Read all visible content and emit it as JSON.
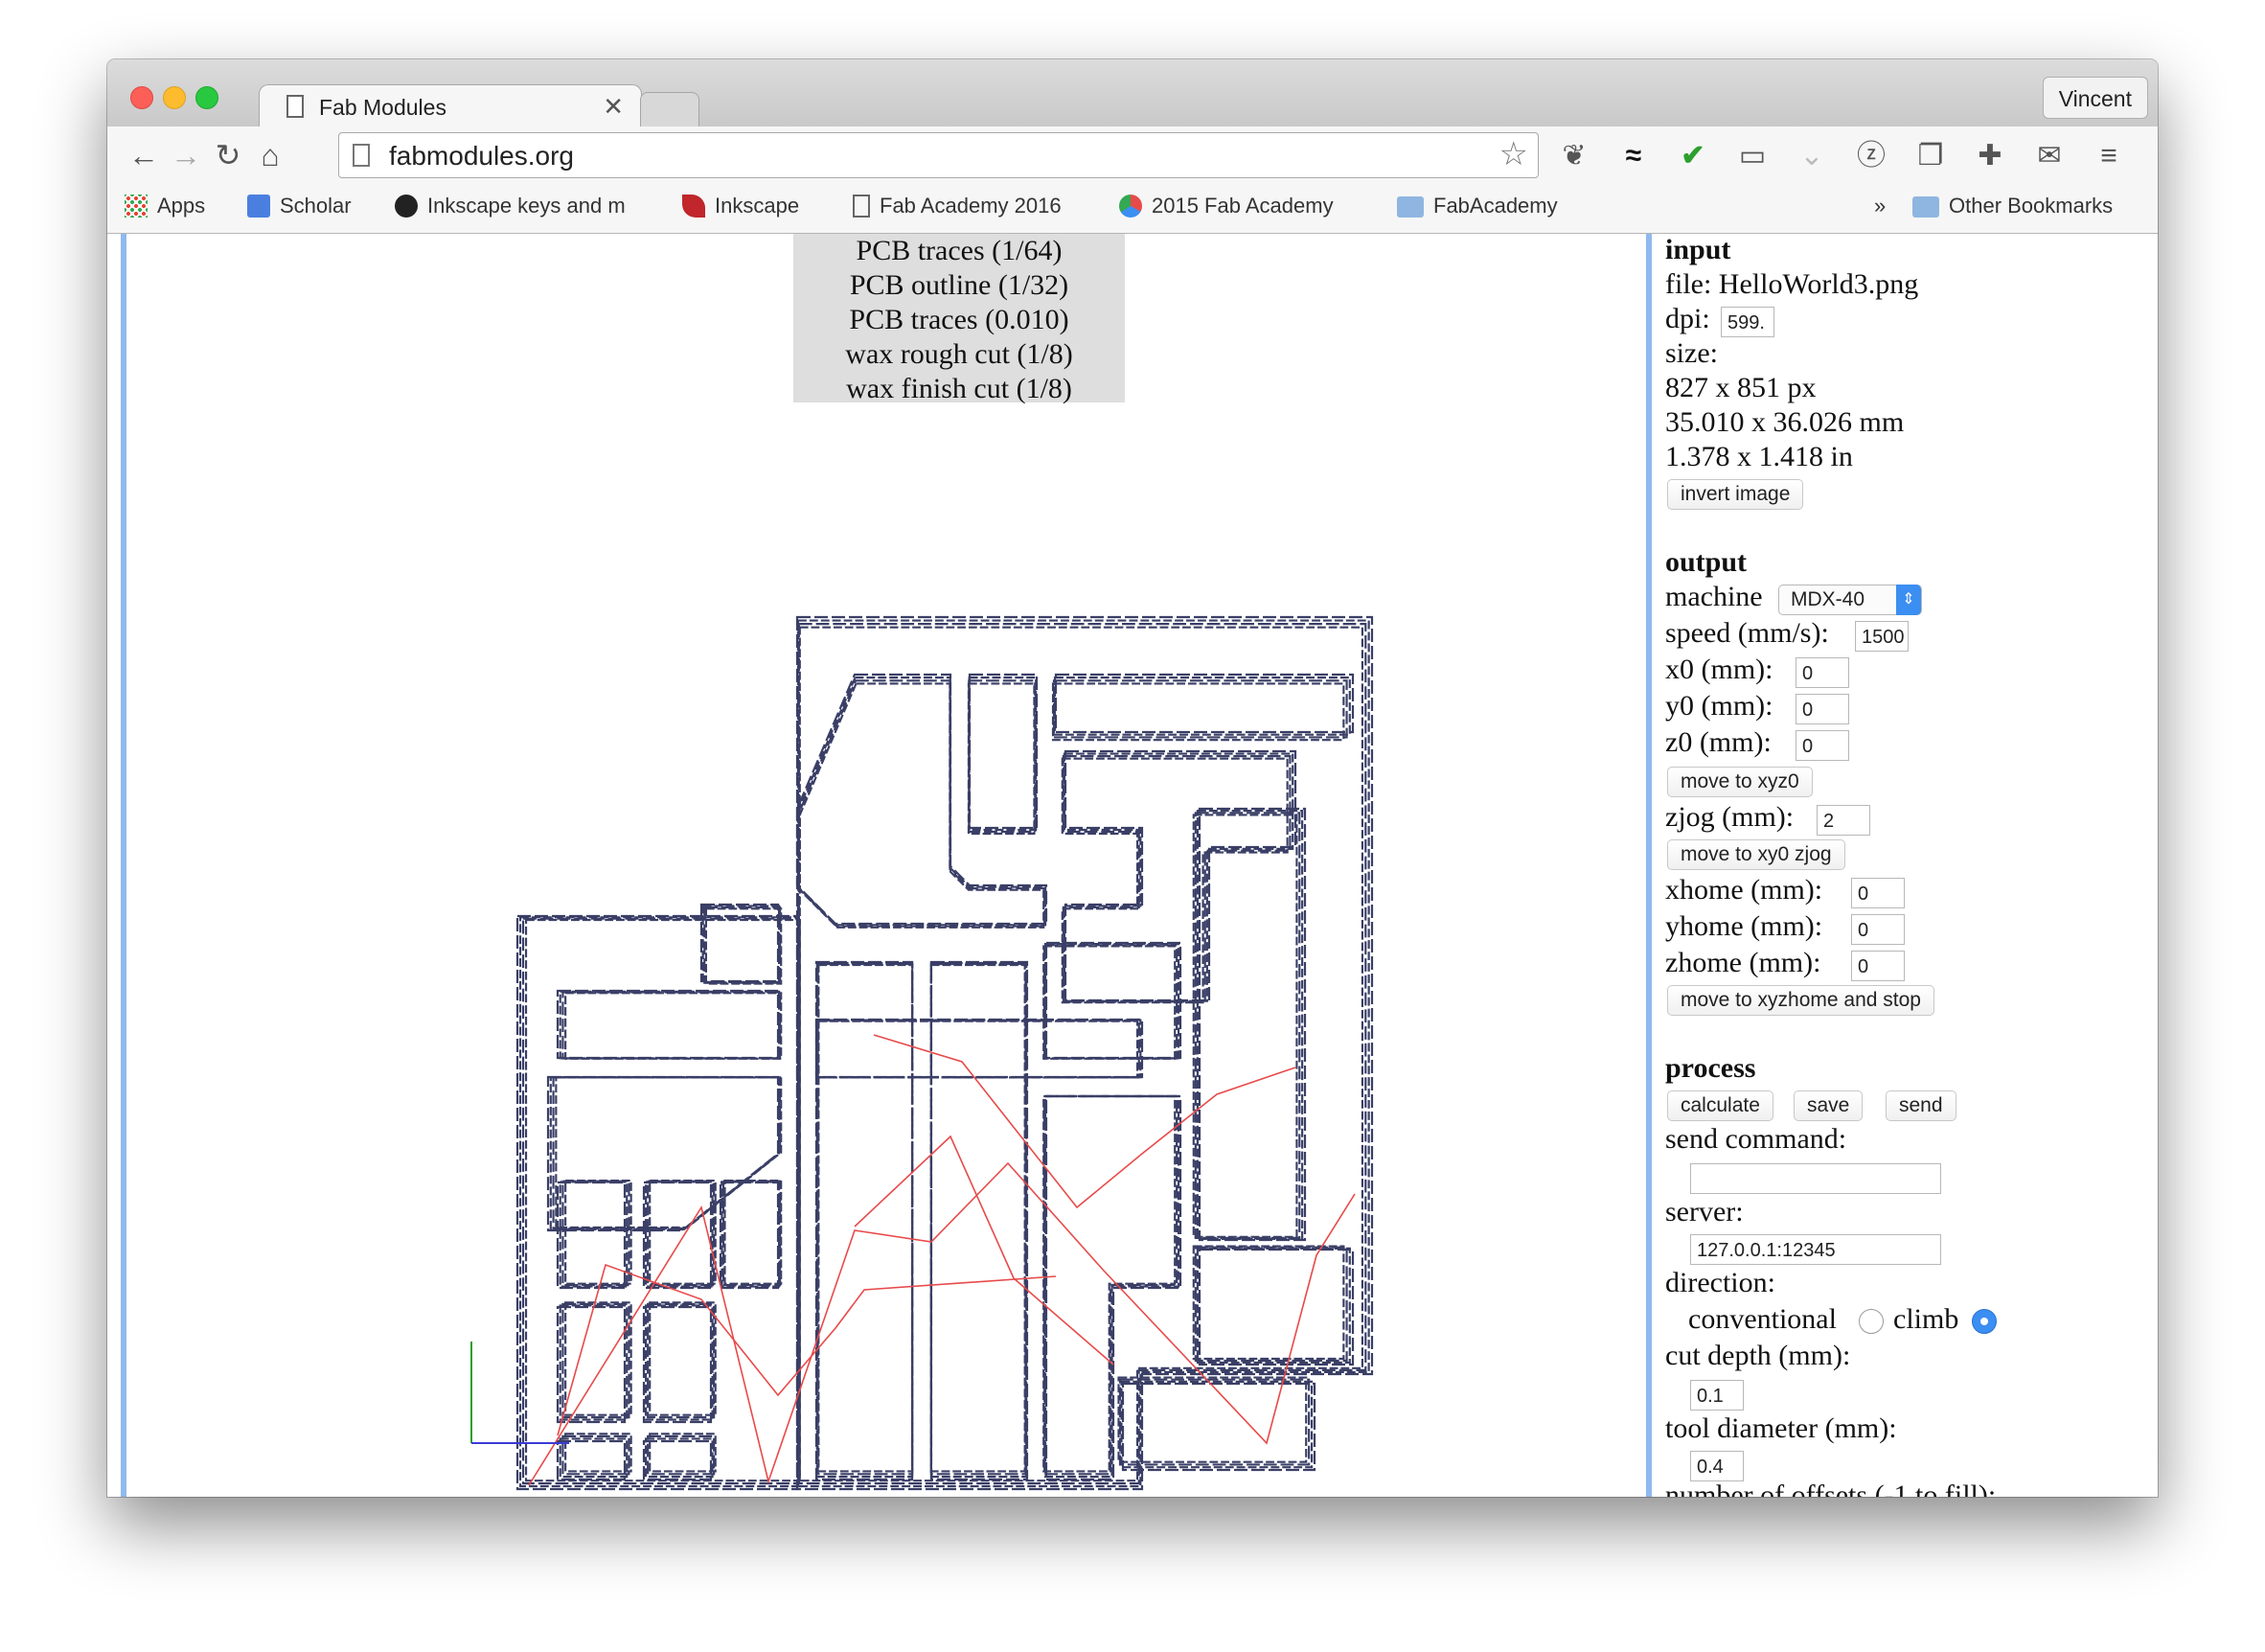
{
  "browser": {
    "tab_title": "Fab Modules",
    "tab_close": "✕",
    "profile_name": "Vincent",
    "url": "fabmodules.org",
    "bookmarks": [
      {
        "label": "Apps"
      },
      {
        "label": "Scholar"
      },
      {
        "label": "Inkscape keys and m"
      },
      {
        "label": "Inkscape"
      },
      {
        "label": "Fab Academy 2016"
      },
      {
        "label": "2015 Fab Academy"
      },
      {
        "label": "FabAcademy"
      }
    ],
    "bookmarks_overflow": "»",
    "other_bookmarks": "Other Bookmarks"
  },
  "process_menu": [
    "PCB traces (1/64)",
    "PCB outline (1/32)",
    "PCB traces (0.010)",
    "wax rough cut (1/8)",
    "wax finish cut (1/8)"
  ],
  "input": {
    "heading": "input",
    "file": "file: HelloWorld3.png",
    "dpi_label": "dpi:",
    "dpi_value": "599.",
    "size_label": "size:",
    "size_px": "827 x 851 px",
    "size_mm": "35.010 x 36.026 mm",
    "size_in": "1.378 x 1.418 in",
    "invert_button": "invert image"
  },
  "output": {
    "heading": "output",
    "machine_label": "machine",
    "machine_value": "MDX-40",
    "speed_label": "speed (mm/s):",
    "speed_value": "1500",
    "x0_label": "x0 (mm):",
    "x0_value": "0",
    "y0_label": "y0 (mm):",
    "y0_value": "0",
    "z0_label": "z0 (mm):",
    "z0_value": "0",
    "move_xyz0_button": "move to xyz0",
    "zjog_label": "zjog (mm):",
    "zjog_value": "2",
    "move_xy0_zjog_button": "move to xy0 zjog",
    "xhome_label": "xhome (mm):",
    "xhome_value": "0",
    "yhome_label": "yhome (mm):",
    "yhome_value": "0",
    "zhome_label": "zhome (mm):",
    "zhome_value": "0",
    "move_home_button": "move to xyzhome and stop"
  },
  "process": {
    "heading": "process",
    "calculate_button": "calculate",
    "save_button": "save",
    "send_button": "send",
    "send_command_label": "send command:",
    "send_command_value": "",
    "server_label": "server:",
    "server_value": "127.0.0.1:12345",
    "direction_label": "direction:",
    "conventional_label": "conventional",
    "climb_label": "climb",
    "direction_selected": "climb",
    "cut_depth_label": "cut depth (mm):",
    "cut_depth_value": "0.1",
    "tool_diameter_label": "tool diameter (mm):",
    "tool_diameter_value": "0.4",
    "offsets_label": "number of offsets (-1 to fill):"
  },
  "colors": {
    "accent_bar": "#8fb9ee",
    "toolpath": "#3a3f66",
    "rapid_move": "#e84a4a",
    "radio_selected": "#3b8ef2"
  }
}
